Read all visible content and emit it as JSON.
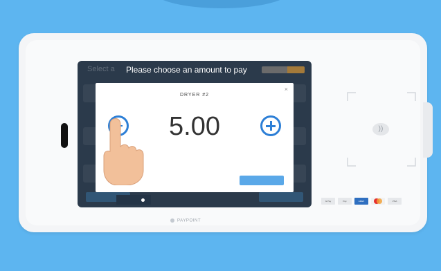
{
  "screen": {
    "prompt": "Please choose an amount to pay",
    "background_text": "Select a",
    "modal": {
      "title": "DRYER #2",
      "close_label": "×",
      "amount": "5.00",
      "amount_sub": "",
      "confirm_label": ""
    }
  },
  "reader": {
    "nfc_label": "",
    "nfc_icon": "contactless-icon"
  },
  "payment_cards": [
    "G Pay",
    "Pay",
    "AMEX",
    "MC",
    "VISA"
  ],
  "brand_logo": "PAYPOINT",
  "colors": {
    "background": "#5db5f0",
    "accent": "#2d7fd6"
  }
}
